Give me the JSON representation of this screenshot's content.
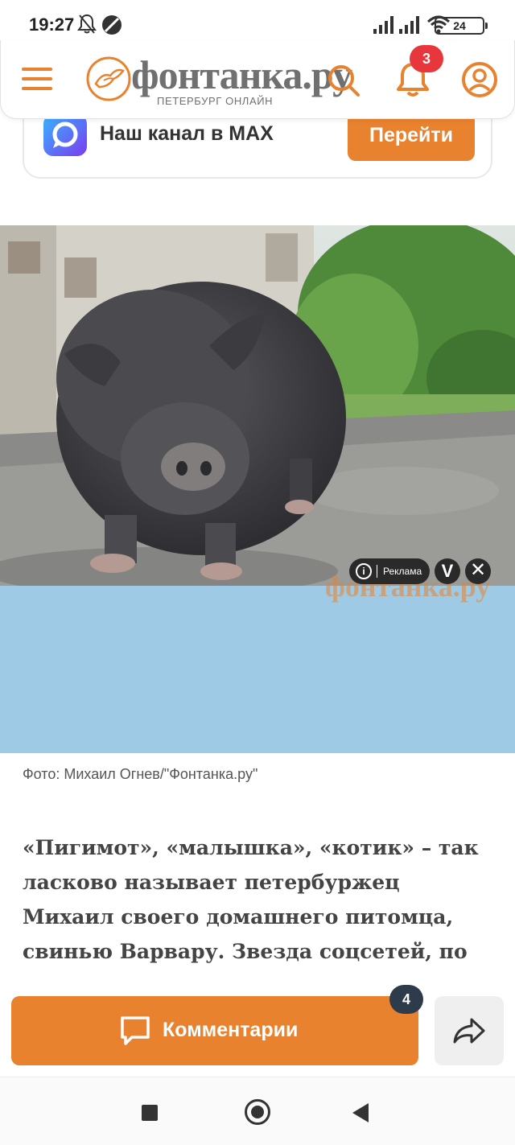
{
  "status_bar": {
    "time": "19:27",
    "battery": "24",
    "icons": [
      "bell-off-icon",
      "do-not-disturb-icon",
      "signal-icon",
      "signal-icon",
      "wifi-icon",
      "battery-icon"
    ]
  },
  "header": {
    "logo_name": "фонтанка.ру",
    "logo_subtitle": "ПЕТЕРБУРГ ОНЛАЙН",
    "notifications_count": "3",
    "accent_color": "#e8822e",
    "badge_color": "#e8373c"
  },
  "banner": {
    "text": "Наш канал в MAX",
    "button_label": "Перейти"
  },
  "photo": {
    "watermark": "фонтанка.ру",
    "ad_label": "Реклама",
    "ad_info": "i",
    "ad_v": "V",
    "ad_close": "✕"
  },
  "caption": "Фото: Михаил Огнев/\"Фонтанка.ру\"",
  "lead": "«Пигимот», «малышка», «котик» – так ласково называет петербуржец Михаил своего домашнего питомца, свинью Варвару. Звезда соцсетей, по",
  "bottom_bar": {
    "comments_label": "Комментарии",
    "comments_count": "4"
  }
}
